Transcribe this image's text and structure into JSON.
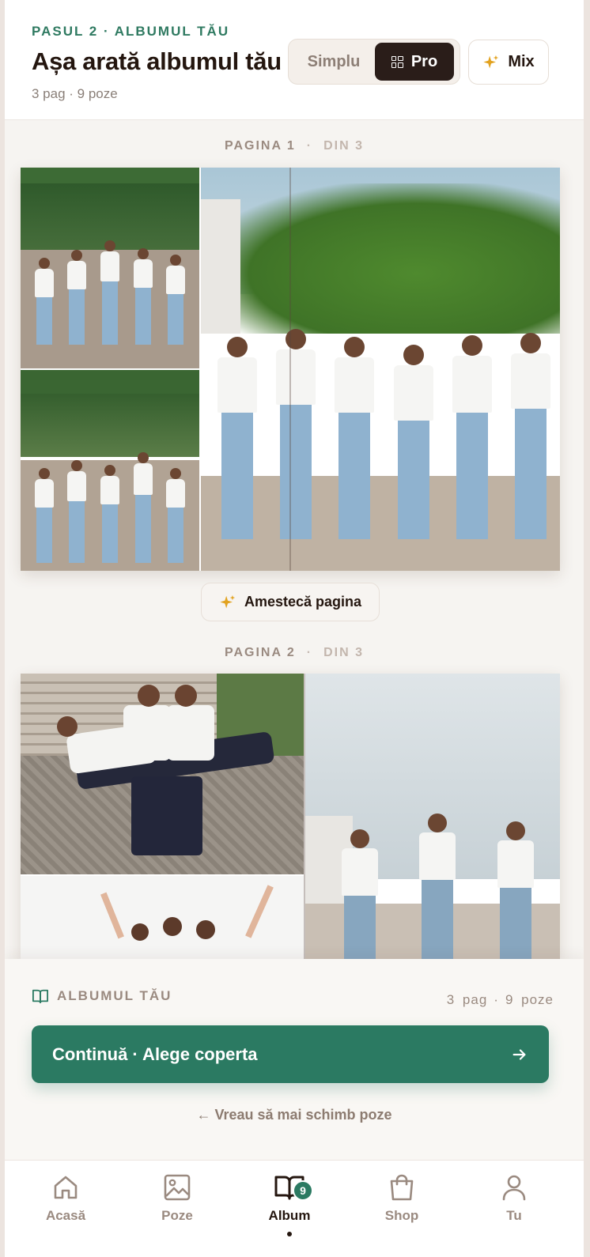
{
  "header": {
    "step_label": "PASUL 2 · ALBUMUL TĂU",
    "title": "Așa arată albumul tău",
    "subtitle": "3 pag · 9 poze",
    "mode_simple": "Simplu",
    "mode_pro": "Pro",
    "mix_label": "Mix",
    "active_mode": "Pro"
  },
  "pages": [
    {
      "label": "PAGINA 1",
      "of": "DIN 3",
      "shuffle_label": "Amestecă pagina"
    },
    {
      "label": "PAGINA 2",
      "of": "DIN 3"
    }
  ],
  "sheet": {
    "title": "ALBUMUL TĂU",
    "pages_count": "3 pag",
    "photos_count": "9 poze",
    "cta_label": "Continuă · Alege coperta",
    "back_link": "← Vreau să mai schimb poze"
  },
  "tabbar": {
    "items": [
      {
        "label": "Acasă",
        "icon": "home-icon"
      },
      {
        "label": "Poze",
        "icon": "image-icon"
      },
      {
        "label": "Album",
        "icon": "book-icon",
        "badge": "9",
        "active": true
      },
      {
        "label": "Shop",
        "icon": "bag-icon"
      },
      {
        "label": "Tu",
        "icon": "user-icon"
      }
    ]
  },
  "colors": {
    "accent": "#2b7a62",
    "dark": "#2a1d19",
    "sparkle": "#e2a21f"
  }
}
